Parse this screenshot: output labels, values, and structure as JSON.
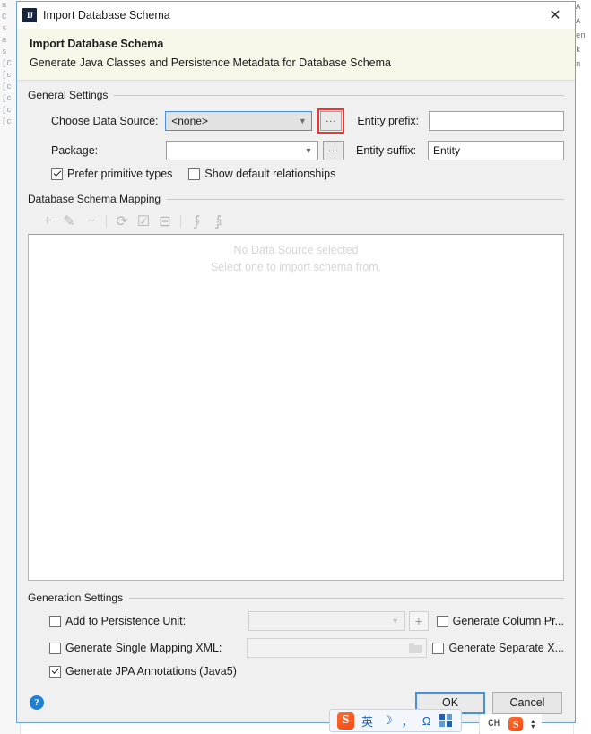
{
  "window": {
    "title": "Import Database Schema",
    "icon": "IJ",
    "close_label": "✕"
  },
  "banner": {
    "title": "Import Database Schema",
    "subtitle": "Generate Java Classes and Persistence Metadata for Database Schema"
  },
  "general_settings": {
    "group_label": "General Settings",
    "data_source_label": "Choose Data Source:",
    "data_source_value": "<none>",
    "data_source_browse": "...",
    "package_label": "Package:",
    "package_value": "",
    "package_browse": "...",
    "entity_prefix_label": "Entity prefix:",
    "entity_prefix_value": "",
    "entity_suffix_label": "Entity suffix:",
    "entity_suffix_value": "Entity",
    "prefer_primitive_label": "Prefer primitive types",
    "prefer_primitive_checked": true,
    "show_default_rel_label": "Show default relationships",
    "show_default_rel_checked": false
  },
  "schema_mapping": {
    "group_label": "Database Schema Mapping",
    "toolbar": [
      {
        "name": "add-icon",
        "glyph": "+"
      },
      {
        "name": "edit-pencil-icon",
        "glyph": "✎"
      },
      {
        "name": "remove-icon",
        "glyph": "−"
      },
      {
        "name": "separator",
        "glyph": ""
      },
      {
        "name": "refresh-icon",
        "glyph": "⟳"
      },
      {
        "name": "select-all-icon",
        "glyph": "☑"
      },
      {
        "name": "deselect-all-icon",
        "glyph": "⊟"
      },
      {
        "name": "separator",
        "glyph": ""
      },
      {
        "name": "expand-all-icon",
        "glyph": "⨓"
      },
      {
        "name": "collapse-all-icon",
        "glyph": "⨒"
      }
    ],
    "empty_line1": "No Data Source selected",
    "empty_line2": "Select one to import schema from."
  },
  "generation_settings": {
    "group_label": "Generation Settings",
    "add_persistence_label": "Add to Persistence Unit:",
    "add_persistence_checked": false,
    "persistence_unit_value": "",
    "persistence_add_button": "+",
    "generate_column_label": "Generate Column Pr...",
    "generate_column_checked": false,
    "single_mapping_label": "Generate Single Mapping XML:",
    "single_mapping_checked": false,
    "single_mapping_path": "",
    "generate_separate_label": "Generate Separate X...",
    "generate_separate_checked": false,
    "jpa_annotations_label": "Generate JPA Annotations (Java5)",
    "jpa_annotations_checked": true
  },
  "footer": {
    "help_label": "?",
    "ok_label": "OK",
    "cancel_label": "Cancel"
  },
  "ime_bar": {
    "logo": "S",
    "mode": "英",
    "moon": "☽",
    "comma": "，",
    "omega": "Ω",
    "grid": "grid"
  },
  "tray": {
    "language": "CH",
    "sogou": "S",
    "spinner_up": "▴",
    "spinner_down": "▾"
  },
  "background": {
    "gutter_lines": [
      "a",
      "C",
      "s",
      "",
      "a",
      "",
      "",
      "",
      "",
      "",
      "",
      "",
      "",
      "",
      "",
      "",
      "",
      "",
      "",
      "",
      "",
      "",
      "",
      "",
      "",
      "",
      "",
      "",
      "",
      "",
      "",
      "",
      "",
      "",
      "",
      "",
      "",
      "",
      "",
      "s",
      "[C",
      "[c",
      "[c",
      "[c",
      "[c",
      "[c",
      "",
      "",
      ""
    ],
    "right_lines": [
      "",
      "",
      "A",
      "A",
      "",
      "",
      "",
      "",
      "",
      "",
      "",
      "",
      "",
      "",
      "",
      "",
      "",
      "en",
      "",
      "",
      "",
      "",
      "",
      "",
      "",
      "",
      "",
      "",
      "",
      "",
      "",
      "",
      "",
      "",
      "",
      "",
      "",
      "k",
      "n",
      "",
      "",
      "",
      "",
      "",
      "",
      "",
      "",
      ""
    ]
  }
}
